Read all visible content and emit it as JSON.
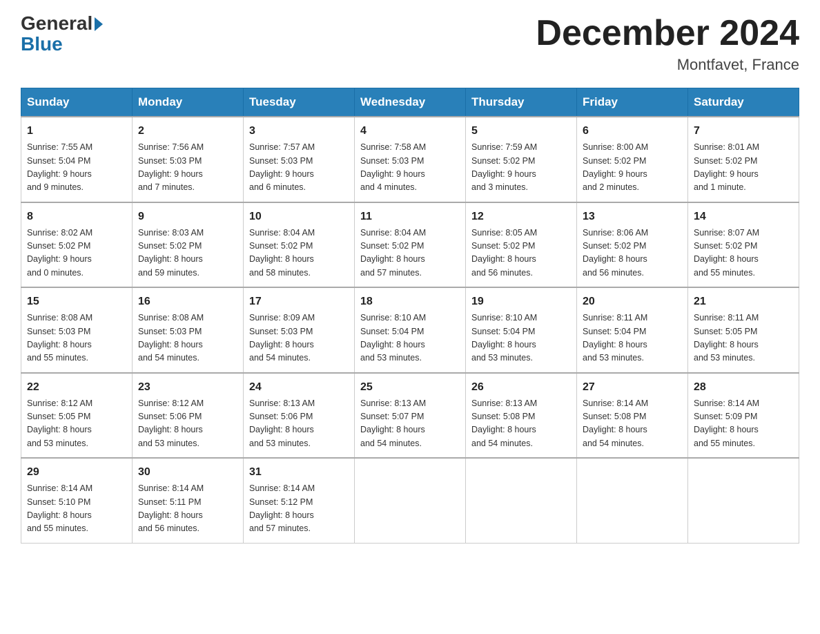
{
  "logo": {
    "general": "General",
    "blue": "Blue"
  },
  "title": "December 2024",
  "location": "Montfavet, France",
  "days_of_week": [
    "Sunday",
    "Monday",
    "Tuesday",
    "Wednesday",
    "Thursday",
    "Friday",
    "Saturday"
  ],
  "weeks": [
    [
      {
        "day": "1",
        "sunrise": "7:55 AM",
        "sunset": "5:04 PM",
        "daylight": "9 hours and 9 minutes."
      },
      {
        "day": "2",
        "sunrise": "7:56 AM",
        "sunset": "5:03 PM",
        "daylight": "9 hours and 7 minutes."
      },
      {
        "day": "3",
        "sunrise": "7:57 AM",
        "sunset": "5:03 PM",
        "daylight": "9 hours and 6 minutes."
      },
      {
        "day": "4",
        "sunrise": "7:58 AM",
        "sunset": "5:03 PM",
        "daylight": "9 hours and 4 minutes."
      },
      {
        "day": "5",
        "sunrise": "7:59 AM",
        "sunset": "5:02 PM",
        "daylight": "9 hours and 3 minutes."
      },
      {
        "day": "6",
        "sunrise": "8:00 AM",
        "sunset": "5:02 PM",
        "daylight": "9 hours and 2 minutes."
      },
      {
        "day": "7",
        "sunrise": "8:01 AM",
        "sunset": "5:02 PM",
        "daylight": "9 hours and 1 minute."
      }
    ],
    [
      {
        "day": "8",
        "sunrise": "8:02 AM",
        "sunset": "5:02 PM",
        "daylight": "9 hours and 0 minutes."
      },
      {
        "day": "9",
        "sunrise": "8:03 AM",
        "sunset": "5:02 PM",
        "daylight": "8 hours and 59 minutes."
      },
      {
        "day": "10",
        "sunrise": "8:04 AM",
        "sunset": "5:02 PM",
        "daylight": "8 hours and 58 minutes."
      },
      {
        "day": "11",
        "sunrise": "8:04 AM",
        "sunset": "5:02 PM",
        "daylight": "8 hours and 57 minutes."
      },
      {
        "day": "12",
        "sunrise": "8:05 AM",
        "sunset": "5:02 PM",
        "daylight": "8 hours and 56 minutes."
      },
      {
        "day": "13",
        "sunrise": "8:06 AM",
        "sunset": "5:02 PM",
        "daylight": "8 hours and 56 minutes."
      },
      {
        "day": "14",
        "sunrise": "8:07 AM",
        "sunset": "5:02 PM",
        "daylight": "8 hours and 55 minutes."
      }
    ],
    [
      {
        "day": "15",
        "sunrise": "8:08 AM",
        "sunset": "5:03 PM",
        "daylight": "8 hours and 55 minutes."
      },
      {
        "day": "16",
        "sunrise": "8:08 AM",
        "sunset": "5:03 PM",
        "daylight": "8 hours and 54 minutes."
      },
      {
        "day": "17",
        "sunrise": "8:09 AM",
        "sunset": "5:03 PM",
        "daylight": "8 hours and 54 minutes."
      },
      {
        "day": "18",
        "sunrise": "8:10 AM",
        "sunset": "5:04 PM",
        "daylight": "8 hours and 53 minutes."
      },
      {
        "day": "19",
        "sunrise": "8:10 AM",
        "sunset": "5:04 PM",
        "daylight": "8 hours and 53 minutes."
      },
      {
        "day": "20",
        "sunrise": "8:11 AM",
        "sunset": "5:04 PM",
        "daylight": "8 hours and 53 minutes."
      },
      {
        "day": "21",
        "sunrise": "8:11 AM",
        "sunset": "5:05 PM",
        "daylight": "8 hours and 53 minutes."
      }
    ],
    [
      {
        "day": "22",
        "sunrise": "8:12 AM",
        "sunset": "5:05 PM",
        "daylight": "8 hours and 53 minutes."
      },
      {
        "day": "23",
        "sunrise": "8:12 AM",
        "sunset": "5:06 PM",
        "daylight": "8 hours and 53 minutes."
      },
      {
        "day": "24",
        "sunrise": "8:13 AM",
        "sunset": "5:06 PM",
        "daylight": "8 hours and 53 minutes."
      },
      {
        "day": "25",
        "sunrise": "8:13 AM",
        "sunset": "5:07 PM",
        "daylight": "8 hours and 54 minutes."
      },
      {
        "day": "26",
        "sunrise": "8:13 AM",
        "sunset": "5:08 PM",
        "daylight": "8 hours and 54 minutes."
      },
      {
        "day": "27",
        "sunrise": "8:14 AM",
        "sunset": "5:08 PM",
        "daylight": "8 hours and 54 minutes."
      },
      {
        "day": "28",
        "sunrise": "8:14 AM",
        "sunset": "5:09 PM",
        "daylight": "8 hours and 55 minutes."
      }
    ],
    [
      {
        "day": "29",
        "sunrise": "8:14 AM",
        "sunset": "5:10 PM",
        "daylight": "8 hours and 55 minutes."
      },
      {
        "day": "30",
        "sunrise": "8:14 AM",
        "sunset": "5:11 PM",
        "daylight": "8 hours and 56 minutes."
      },
      {
        "day": "31",
        "sunrise": "8:14 AM",
        "sunset": "5:12 PM",
        "daylight": "8 hours and 57 minutes."
      },
      null,
      null,
      null,
      null
    ]
  ],
  "labels": {
    "sunrise": "Sunrise:",
    "sunset": "Sunset:",
    "daylight": "Daylight:"
  }
}
